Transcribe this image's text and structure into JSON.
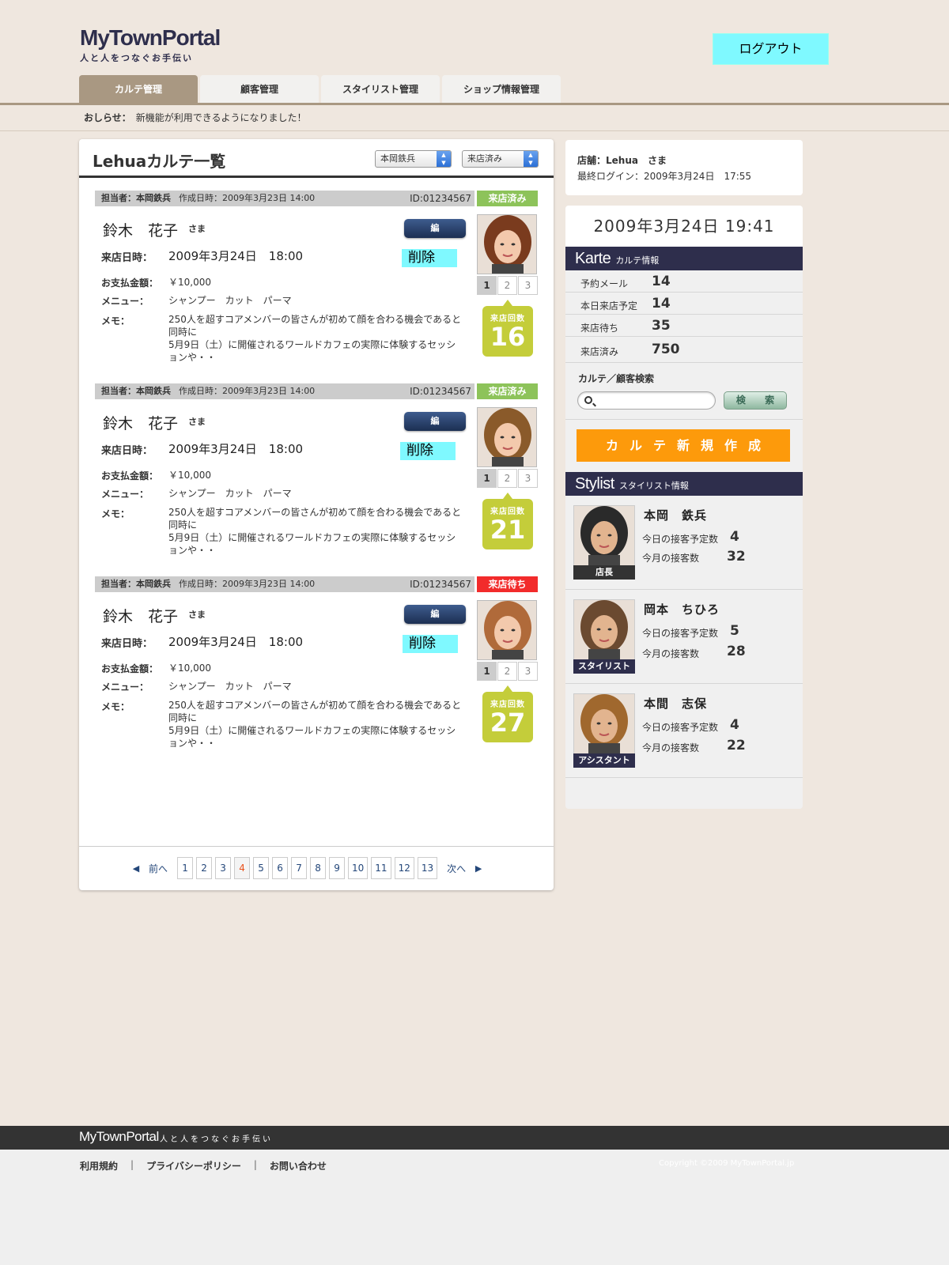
{
  "header": {
    "logo": "MyTownPortal",
    "tagline": "人と人をつなぐお手伝い",
    "logout": "ログアウト"
  },
  "nav": [
    "カルテ管理",
    "顧客管理",
    "スタイリスト管理",
    "ショップ情報管理"
  ],
  "notice": {
    "label": "おしらせ：",
    "text": "新機能が利用できるようになりました！"
  },
  "main": {
    "title": "Lehuaカルテ一覧",
    "filter_stylist": "本岡鉄兵",
    "filter_status": "来店済み",
    "labels": {
      "visit_date": "来店日時：",
      "amount": "お支払金額：",
      "menu": "メニュー：",
      "memo": "メモ：",
      "edit": "編　集",
      "delete": "削除",
      "visit_count": "来店回数",
      "sama": "さま"
    },
    "cards": [
      {
        "staff": "担当者：本岡鉄兵",
        "created": "作成日時：2009年3月23日 14:00",
        "id": "ID:01234567",
        "status": "来店済み",
        "name": "鈴木　花子",
        "visit": "2009年3月24日　18:00",
        "amount": "￥10,000",
        "menu": "シャンプー　カット　パーマ",
        "memo1": "250人を超すコアメンバーの皆さんが初めて顔を合わる機会であると同時に",
        "memo2": "5月9日（土）に開催されるワールドカフェの実際に体験するセッションや・・",
        "pages": [
          "1",
          "2",
          "3"
        ],
        "count": "16"
      },
      {
        "staff": "担当者：本岡鉄兵",
        "created": "作成日時：2009年3月23日 14:00",
        "id": "ID:01234567",
        "status": "来店済み",
        "name": "鈴木　花子",
        "visit": "2009年3月24日　18:00",
        "amount": "￥10,000",
        "menu": "シャンプー　カット　パーマ",
        "memo1": "250人を超すコアメンバーの皆さんが初めて顔を合わる機会であると同時に",
        "memo2": "5月9日（土）に開催されるワールドカフェの実際に体験するセッションや・・",
        "pages": [
          "1",
          "2",
          "3"
        ],
        "count": "21"
      },
      {
        "staff": "担当者：本岡鉄兵",
        "created": "作成日時：2009年3月23日 14:00",
        "id": "ID:01234567",
        "status": "来店待ち",
        "name": "鈴木　花子",
        "visit": "2009年3月24日　18:00",
        "amount": "￥10,000",
        "menu": "シャンプー　カット　パーマ",
        "memo1": "250人を超すコアメンバーの皆さんが初めて顔を合わる機会であると同時に",
        "memo2": "5月9日（土）に開催されるワールドカフェの実際に体験するセッションや・・",
        "pages": [
          "1",
          "2",
          "3"
        ],
        "count": "27"
      }
    ],
    "pagination": {
      "prev": "前へ",
      "next": "次へ",
      "pages": [
        "1",
        "2",
        "3",
        "4",
        "5",
        "6",
        "7",
        "8",
        "9",
        "10",
        "11",
        "12",
        "13"
      ],
      "current": "4"
    }
  },
  "side": {
    "shop_name": "店舗：Lehua　さま",
    "last_login": "最終ログイン：2009年3月24日　17:55",
    "clock": "2009年3月24日 19:41",
    "karte_head": "Karte",
    "karte_sub": "カルテ情報",
    "stats": [
      {
        "label": "予約メール",
        "value": "14"
      },
      {
        "label": "本日来店予定",
        "value": "14"
      },
      {
        "label": "来店待ち",
        "value": "35"
      },
      {
        "label": "来店済み",
        "value": "750"
      }
    ],
    "search_label": "カルテ／顧客検索",
    "search_placeholder": "",
    "search_button": "検 索",
    "new_karte": "カルテ新規作成",
    "stylist_head": "Stylist",
    "stylist_sub": "スタイリスト情報",
    "stylist_labels": {
      "today": "今日の接客予定数",
      "month": "今月の接客数"
    },
    "stylists": [
      {
        "name": "本岡　鉄兵",
        "role": "店長",
        "today": "4",
        "month": "32"
      },
      {
        "name": "岡本　ちひろ",
        "role": "スタイリスト",
        "today": "5",
        "month": "28"
      },
      {
        "name": "本間　志保",
        "role": "アシスタント",
        "today": "4",
        "month": "22"
      }
    ]
  },
  "footer": {
    "logo": "MyTownPortal",
    "tagline": "人と人をつなぐお手伝い",
    "links": [
      "利用規約",
      "プライバシーポリシー",
      "お問い合わせ"
    ],
    "separator": "|",
    "copyright": "Copyright ©2009 MyTownPortal.jp"
  },
  "colors": {
    "bg": "#efe7df",
    "accent_nav": "#a99882",
    "navy": "#2e2e4c",
    "status_done": "#8dc35a",
    "status_wait": "#f22b2b",
    "badge": "#c4cd3a",
    "new_button": "#fd9a0b",
    "highlight": "#7ff9ff"
  }
}
